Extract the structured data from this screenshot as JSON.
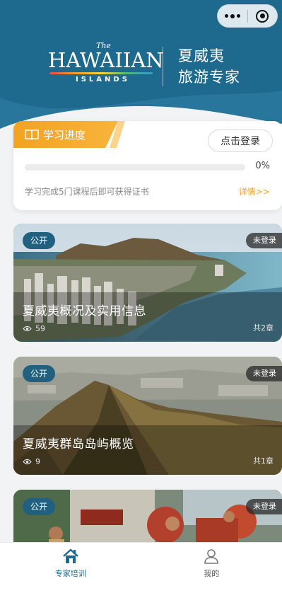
{
  "header": {
    "logo": {
      "the": "The",
      "main": "HAWAIIAN",
      "sub": "ISLANDS"
    },
    "title_line1": "夏威夷",
    "title_line2": "旅游专家",
    "bg_color": "#1e6a8e"
  },
  "capsule": {
    "more_icon": "more-dots-icon",
    "close_icon": "target-close-icon"
  },
  "progress": {
    "tag_label": "学习进度",
    "login_label": "点击登录",
    "percent_text": "0%",
    "percent_value": 0,
    "note": "学习完成5门课程后即可获得证书",
    "detail_link": "详情>>",
    "accent": "#f2a322"
  },
  "courses": [
    {
      "badge": "公开",
      "status": "未登录",
      "title": "夏威夷概况及实用信息",
      "views": "59",
      "chapters": "共2章"
    },
    {
      "badge": "公开",
      "status": "未登录",
      "title": "夏威夷群岛岛屿概览",
      "views": "9",
      "chapters": "共1章"
    },
    {
      "badge": "公开",
      "status": "未登录",
      "title": "",
      "views": "",
      "chapters": ""
    }
  ],
  "tabbar": {
    "items": [
      {
        "label": "专家培训",
        "icon": "house-icon",
        "active": true
      },
      {
        "label": "我的",
        "icon": "person-icon",
        "active": false
      }
    ],
    "active_color": "#1e6a8e"
  }
}
